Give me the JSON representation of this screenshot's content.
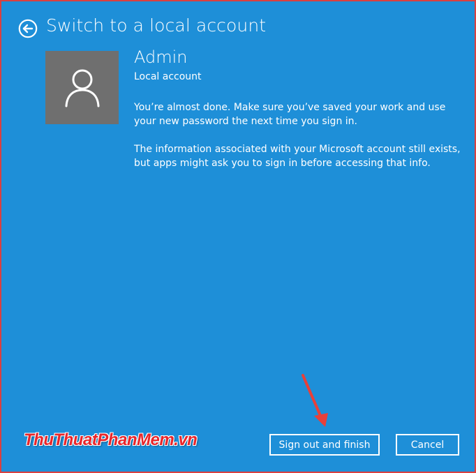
{
  "header": {
    "title": "Switch to a local account",
    "back_icon": "arrow-left-circle-icon"
  },
  "account": {
    "avatar_icon": "user-icon",
    "name": "Admin",
    "type": "Local account"
  },
  "messages": [
    "You’re almost done. Make sure you’ve saved your work and use your new password the next time you sign in.",
    "The information associated with your Microsoft account still exists, but apps might ask you to sign in before accessing that info."
  ],
  "buttons": {
    "primary_label": "Sign out and finish",
    "cancel_label": "Cancel"
  },
  "watermark": {
    "text": "ThuThuatPhanMem.vn"
  },
  "colors": {
    "background": "#1e8fd8",
    "avatar_bg": "#6f6f6f",
    "annotation_arrow": "#e8403a",
    "watermark": "#e8262b"
  }
}
